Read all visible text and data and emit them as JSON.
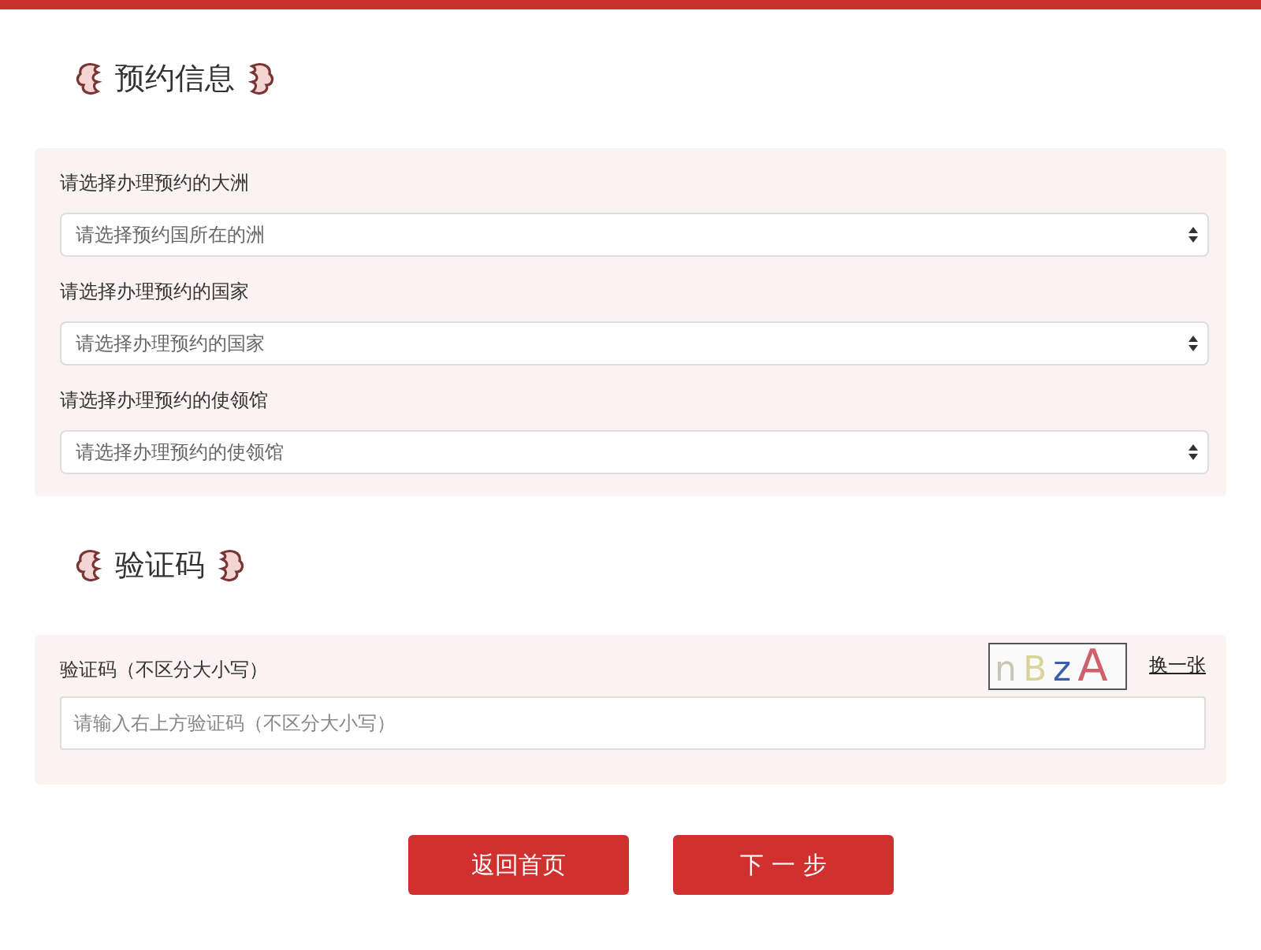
{
  "sections": [
    {
      "title": "预约信息",
      "kind": "selects",
      "fields": [
        {
          "label": "请选择办理预约的大洲",
          "placeholder": "请选择预约国所在的洲"
        },
        {
          "label": "请选择办理预约的国家",
          "placeholder": "请选择办理预约的国家"
        },
        {
          "label": "请选择办理预约的使领馆",
          "placeholder": "请选择办理预约的使领馆"
        }
      ]
    },
    {
      "title": "验证码",
      "kind": "captcha",
      "fields": [
        {
          "label": "验证码（不区分大小写）",
          "placeholder": "请输入右上方验证码（不区分大小写）"
        }
      ],
      "captcha": [
        {
          "char": "n",
          "color": "#c9c7b4"
        },
        {
          "char": "B",
          "color": "#d9d49a"
        },
        {
          "char": "z",
          "color": "#3a5fa8"
        },
        {
          "char": "A",
          "color": "#d0606a"
        }
      ],
      "refresh": "换一张"
    }
  ],
  "buttons": [
    "返回首页",
    "下 一 步"
  ]
}
